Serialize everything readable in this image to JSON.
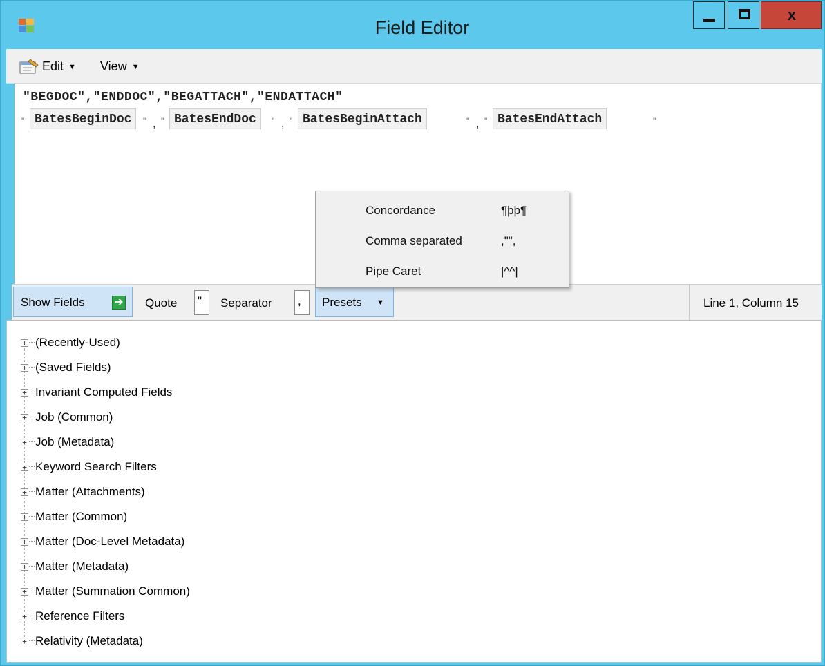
{
  "window": {
    "title": "Field Editor",
    "close_label": "x"
  },
  "menubar": {
    "items": [
      {
        "label": "Edit"
      },
      {
        "label": "View"
      }
    ]
  },
  "editor": {
    "header_line": "\"BEGDOC\",\"ENDDOC\",\"BEGATTACH\",\"ENDATTACH\"",
    "quote_glyph": "\"",
    "separator_glyph": ",",
    "fields": [
      "BatesBeginDoc",
      "BatesEndDoc",
      "BatesBeginAttach",
      "BatesEndAttach"
    ]
  },
  "presets_menu": {
    "items": [
      {
        "label": "Concordance",
        "symbols": "¶þþ¶"
      },
      {
        "label": "Comma separated",
        "symbols": ",\"\","
      },
      {
        "label": "Pipe Caret",
        "symbols": "|^^|"
      }
    ]
  },
  "toolbar": {
    "show_fields_label": "Show Fields",
    "quote_label": "Quote",
    "quote_value": "\"",
    "separator_label": "Separator",
    "separator_value": ",",
    "presets_label": "Presets",
    "status": "Line 1, Column 15"
  },
  "tree": {
    "items": [
      {
        "label": "(Recently-Used)"
      },
      {
        "label": "(Saved Fields)"
      },
      {
        "label": "Invariant Computed Fields"
      },
      {
        "label": "Job (Common)"
      },
      {
        "label": "Job (Metadata)"
      },
      {
        "label": "Keyword Search Filters"
      },
      {
        "label": "Matter (Attachments)"
      },
      {
        "label": "Matter (Common)"
      },
      {
        "label": "Matter (Doc-Level Metadata)"
      },
      {
        "label": "Matter (Metadata)"
      },
      {
        "label": "Matter (Summation Common)"
      },
      {
        "label": "Reference Filters"
      },
      {
        "label": "Relativity (Metadata)"
      }
    ]
  },
  "colors": {
    "titlebar": "#5bc8ec",
    "close_button": "#c7463a",
    "highlight_button": "#cfe4f7"
  }
}
